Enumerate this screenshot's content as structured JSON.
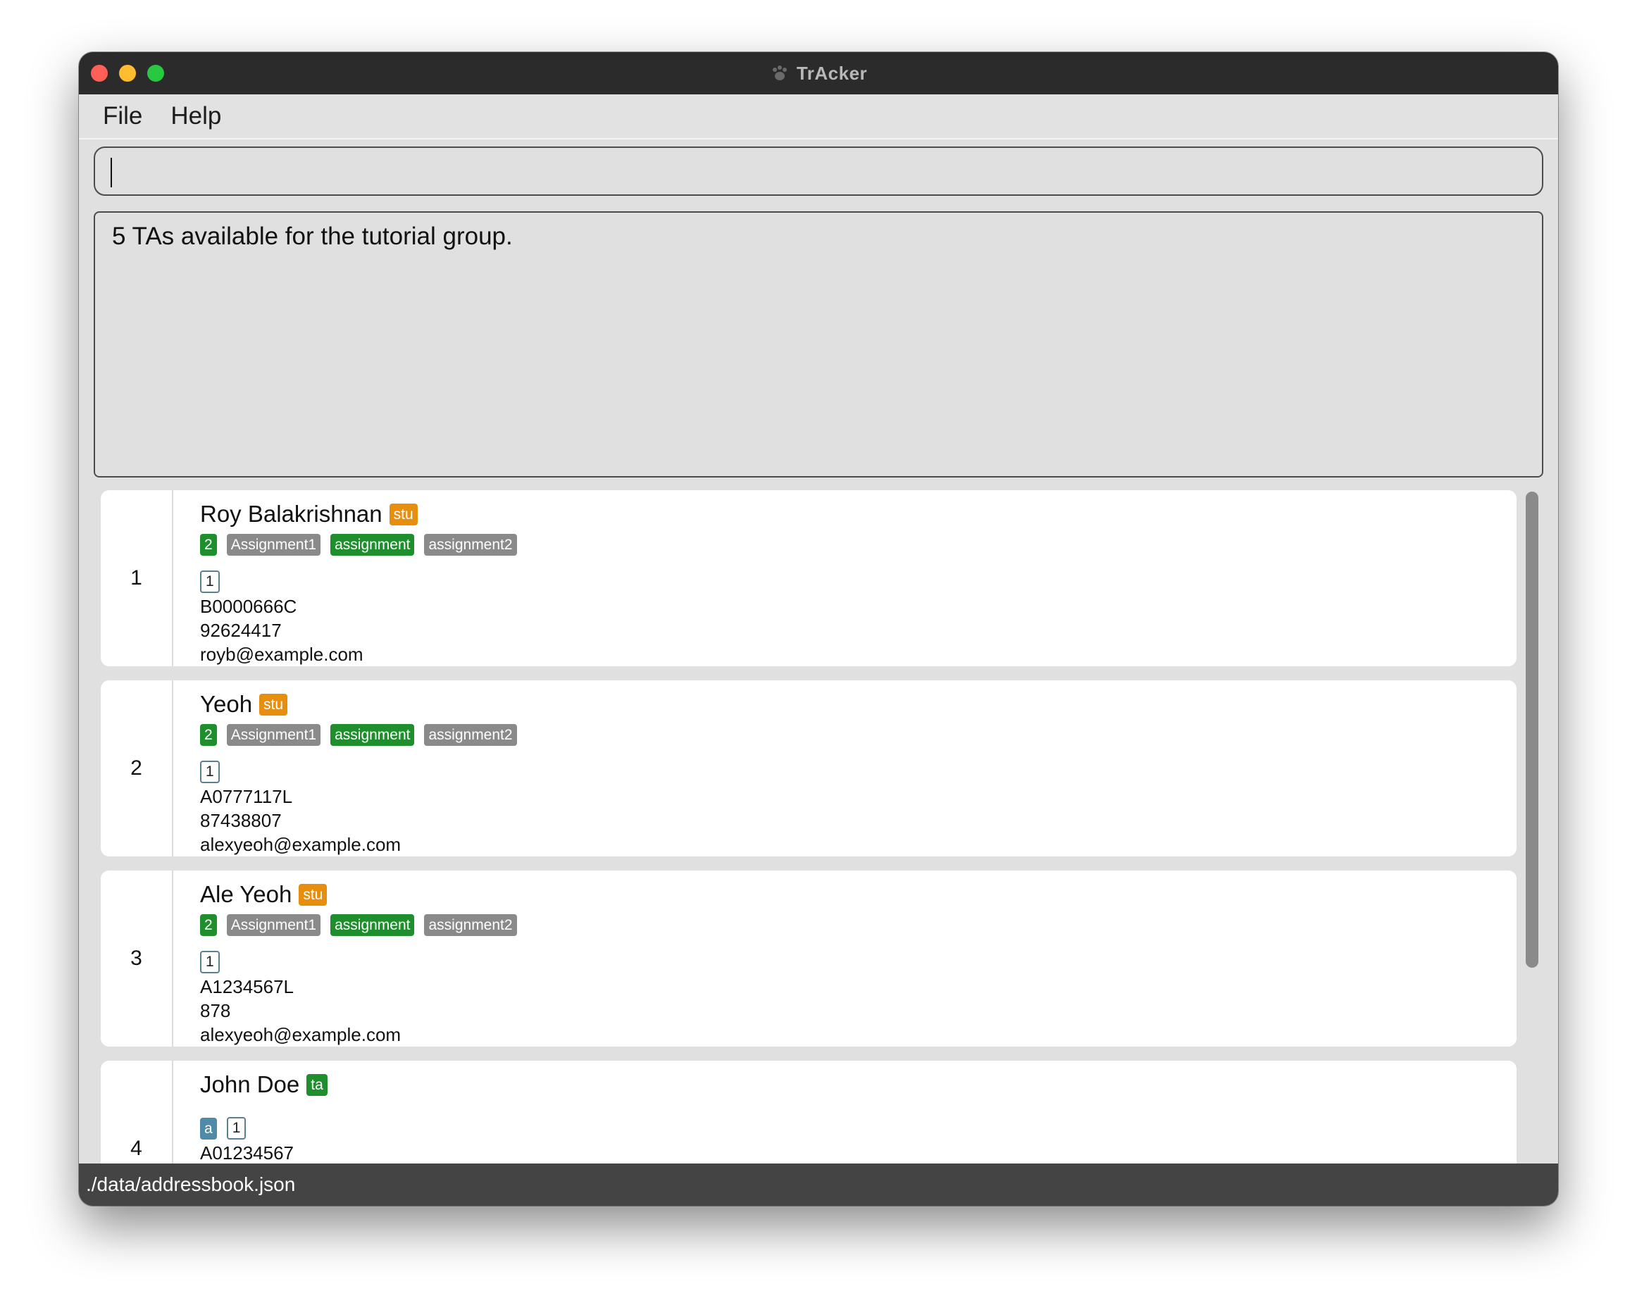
{
  "window": {
    "title": "TrAcker",
    "icon": "paw-icon"
  },
  "menu": {
    "file": "File",
    "help": "Help"
  },
  "command": {
    "value": ""
  },
  "result": {
    "message": "5 TAs available for the tutorial group."
  },
  "persons": [
    {
      "index": "1",
      "name": "Roy Balakrishnan",
      "role": "stu",
      "count": "2",
      "tags": [
        "Assignment1",
        "assignment",
        "assignment2"
      ],
      "group": "1",
      "id": "B0000666C",
      "phone": "92624417",
      "email": "royb@example.com"
    },
    {
      "index": "2",
      "name": "Yeoh",
      "role": "stu",
      "count": "2",
      "tags": [
        "Assignment1",
        "assignment",
        "assignment2"
      ],
      "group": "1",
      "id": "A0777117L",
      "phone": "87438807",
      "email": "alexyeoh@example.com"
    },
    {
      "index": "3",
      "name": "Ale Yeoh",
      "role": "stu",
      "count": "2",
      "tags": [
        "Assignment1",
        "assignment",
        "assignment2"
      ],
      "group": "1",
      "id": "A1234567L",
      "phone": "878",
      "email": "alexyeoh@example.com"
    },
    {
      "index": "4",
      "name": "John Doe",
      "role": "ta",
      "module": "a",
      "group": "1",
      "id": "A01234567"
    }
  ],
  "status": {
    "path": "./data/addressbook.json"
  },
  "colors": {
    "stu_tag": "#e88e0f",
    "ta_tag": "#1f8f2d",
    "count_tag": "#1f8f2d",
    "gray_tag": "#8a8a8a",
    "module_tag": "#4f8aa8"
  }
}
